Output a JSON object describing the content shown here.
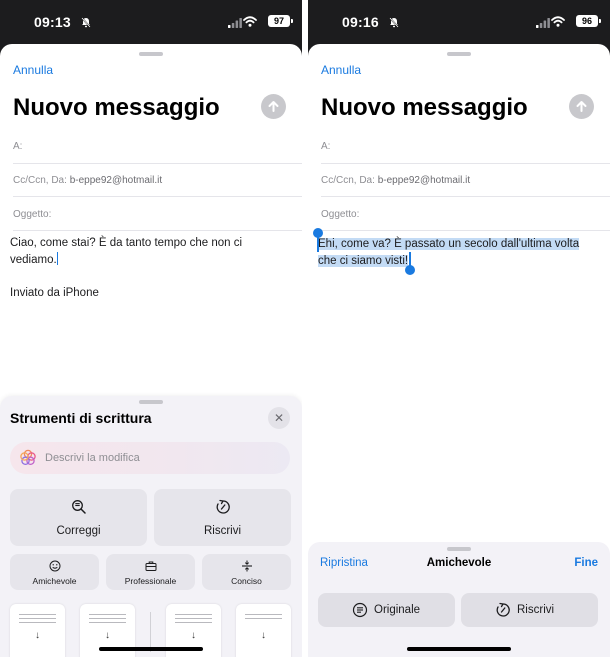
{
  "screens": [
    {
      "status": {
        "time": "09:13",
        "battery": "97"
      },
      "compose": {
        "cancel": "Annulla",
        "title": "Nuovo messaggio",
        "to_label": "A:",
        "cc_label": "Cc/Ccn, Da:",
        "from_value": "b-eppe92@hotmail.it",
        "subject_label": "Oggetto:",
        "body_line1": "Ciao, come stai? È da tanto tempo che non ci",
        "body_line2": "vediamo.",
        "signature": "Inviato da iPhone"
      },
      "writing_tools": {
        "title": "Strumenti di scrittura",
        "describe_placeholder": "Descrivi la modifica",
        "primary_actions": [
          "Correggi",
          "Riscrivi"
        ],
        "tones": [
          "Amichevole",
          "Professionale",
          "Conciso"
        ]
      }
    },
    {
      "status": {
        "time": "09:16",
        "battery": "96"
      },
      "compose": {
        "cancel": "Annulla",
        "title": "Nuovo messaggio",
        "to_label": "A:",
        "cc_label": "Cc/Ccn, Da:",
        "from_value": "b-eppe92@hotmail.it",
        "subject_label": "Oggetto:",
        "body_line1": "Ehi, come va? È passato un secolo dall'ultima volta",
        "body_line2": "che ci siamo visti!"
      },
      "rewrite_bar": {
        "reset": "Ripristina",
        "mode": "Amichevole",
        "done": "Fine",
        "original": "Originale",
        "rewrite": "Riscrivi"
      }
    }
  ],
  "colors": {
    "accent": "#1a7ae0",
    "selection": "#c3dbf5",
    "panel": "#f3f2f7"
  },
  "icons": [
    "bell-slash-icon",
    "signal-icon",
    "wifi-icon",
    "battery-icon",
    "send-arrow-icon",
    "close-icon",
    "apple-intelligence-icon",
    "magnifier-check-icon",
    "rewrite-icon",
    "smile-icon",
    "briefcase-icon",
    "concise-icon",
    "original-icon"
  ]
}
